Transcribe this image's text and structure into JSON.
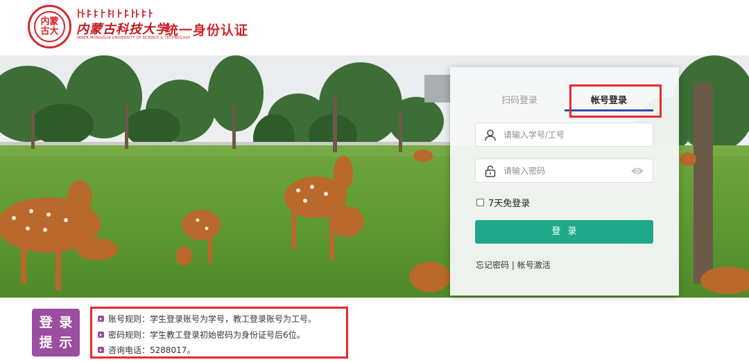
{
  "header": {
    "seal_text": "内蒙古大",
    "university_name": "内蒙古科技大学",
    "university_english": "INNER MONGOLIA UNIVERSITY OF SCIENCE & TECHNOLOGY",
    "system_title": "统一身份认证"
  },
  "login": {
    "tabs": [
      {
        "label": "扫码登录",
        "active": false
      },
      {
        "label": "帐号登录",
        "active": true
      }
    ],
    "username_placeholder": "请输入学号/工号",
    "password_placeholder": "请输入密码",
    "remember_label": "7天免登录",
    "submit_label": "登录",
    "forgot_password": "忘记密码",
    "separator": " | ",
    "activate_account": "帐号激活",
    "icons": {
      "user": "user-icon",
      "lock": "lock-icon",
      "eye": "eye-icon"
    },
    "accent_color": "#1fa98a"
  },
  "tips": {
    "logo_chars": [
      "登",
      "录",
      "提",
      "示"
    ],
    "items": [
      "账号规则：学生登录账号为学号，教工登录账号为工号。",
      "密码规则：学生教工登录初始密码为身份证号后6位。",
      "咨询电话：5288017。"
    ]
  },
  "colors": {
    "brand_red": "#d2232a",
    "highlight_red": "#e8282d",
    "purple": "#9b4d9f"
  }
}
